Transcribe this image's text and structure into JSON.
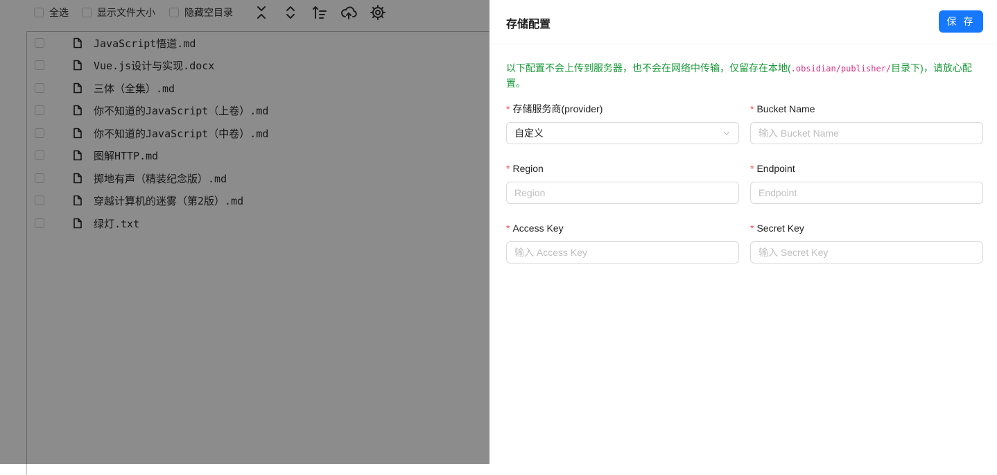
{
  "toolbar": {
    "select_all": "全选",
    "show_size": "显示文件大小",
    "hide_empty": "隐藏空目录",
    "icons": [
      "collapse-all-icon",
      "expand-all-icon",
      "sort-icon",
      "cloud-upload-icon",
      "gear-icon"
    ]
  },
  "files": [
    "JavaScript悟道.md",
    "Vue.js设计与实现.docx",
    "三体（全集）.md",
    "你不知道的JavaScript（上卷）.md",
    "你不知道的JavaScript（中卷）.md",
    "图解HTTP.md",
    "掷地有声（精装纪念版）.md",
    "穿越计算机的迷雾（第2版）.md",
    "绿灯.txt"
  ],
  "drawer": {
    "title": "存储配置",
    "save_label": "保 存",
    "notice_before": "以下配置不会上传到服务器，也不会在网络中传输，仅留存在本地(",
    "notice_code": ".obsidian/publisher/",
    "notice_after": "目录下)，请放心配置。",
    "fields": {
      "provider": {
        "label": "存储服务商(provider)",
        "value": "自定义"
      },
      "bucket": {
        "label": "Bucket Name",
        "placeholder": "输入 Bucket Name"
      },
      "region": {
        "label": "Region",
        "placeholder": "Region"
      },
      "endpoint": {
        "label": "Endpoint",
        "placeholder": "Endpoint"
      },
      "access_key": {
        "label": "Access Key",
        "placeholder": "输入 Access Key"
      },
      "secret_key": {
        "label": "Secret Key",
        "placeholder": "输入 Secret Key"
      }
    },
    "required_mark": "*"
  },
  "colors": {
    "primary": "#1677ff",
    "notice": "#1a9a3a",
    "required": "#ff4d4f",
    "mask": "rgba(0,0,0,0.45)"
  }
}
